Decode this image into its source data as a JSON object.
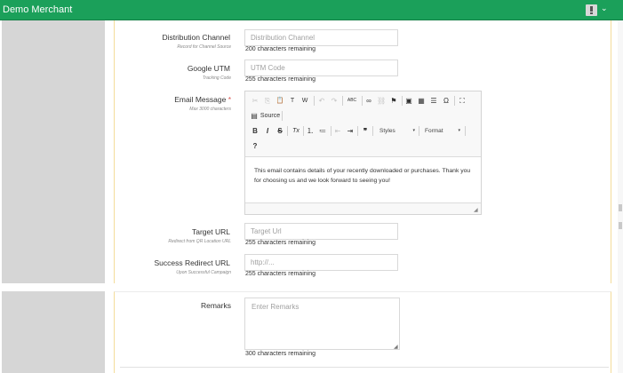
{
  "header": {
    "brand": "Demo Merchant",
    "user_icon": "user-alert-icon",
    "caret": "⌄"
  },
  "fields": {
    "distribution_channel": {
      "label": "Distribution Channel",
      "sublabel": "Record for Channel Source",
      "placeholder": "Distribution Channel",
      "value": "",
      "remaining": "200 characters remaining"
    },
    "google_utm": {
      "label": "Google UTM",
      "sublabel": "Tracking Code",
      "placeholder": "UTM Code",
      "value": "",
      "remaining": "255 characters remaining"
    },
    "email_message": {
      "label": "Email Message",
      "required_mark": "*",
      "sublabel": "Max 3000 characters",
      "body": "This email contains details of your recently downloaded or purchases. Thank you for choosing us and we look forward to seeing you!"
    },
    "target_url": {
      "label": "Target URL",
      "sublabel": "Redirect from QR Location URL",
      "placeholder": "Target Url",
      "value": "",
      "remaining": "255 characters remaining"
    },
    "success_redirect_url": {
      "label": "Success Redirect URL",
      "sublabel": "Upon Successful Campaign",
      "placeholder": "http://...",
      "value": "",
      "remaining": "255 characters remaining"
    },
    "remarks": {
      "label": "Remarks",
      "placeholder": "Enter Remarks",
      "value": "",
      "remaining": "300 characters remaining"
    }
  },
  "editor_toolbar": {
    "row1": {
      "cut": "✂",
      "copy": "⎘",
      "paste": "📋",
      "paste_text": "T",
      "paste_word": "W",
      "undo": "↶",
      "redo": "↷",
      "spell": "ABC",
      "link": "∞",
      "unlink": "⛓",
      "anchor": "⚑",
      "image": "▣",
      "table": "▦",
      "hline": "☰",
      "special_char": "Ω",
      "maximize": "⛶"
    },
    "row2": {
      "source": "Source",
      "source_icon": "▤"
    },
    "row3": {
      "bold": "B",
      "italic": "I",
      "strike": "S",
      "remove_format": "Tx",
      "numbered_list": "⒈",
      "bullet_list": "≔",
      "outdent": "⇤",
      "indent": "⇥",
      "blockquote": "❞",
      "styles": "Styles",
      "format": "Format",
      "dropdown_arrow": "▾"
    },
    "row4": {
      "help": "?"
    },
    "resize_grip": "◢"
  }
}
